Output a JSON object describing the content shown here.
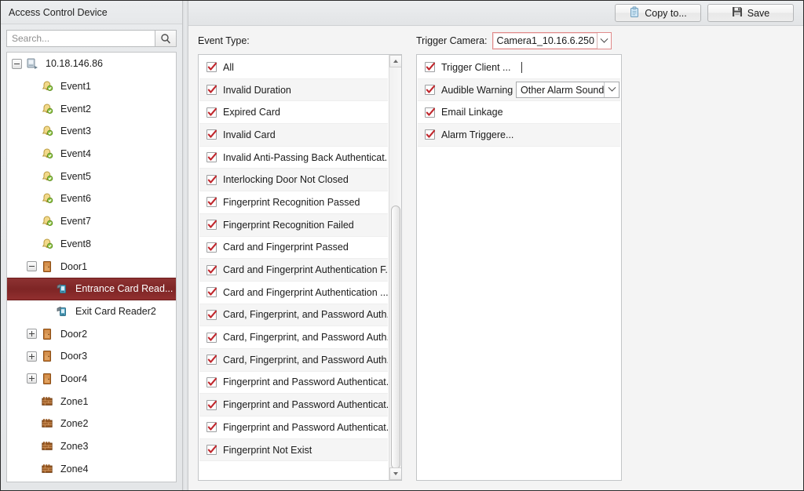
{
  "left_panel": {
    "header_title": "Access Control Device",
    "search": {
      "placeholder": "Search...",
      "value": "",
      "icon": "search-icon"
    },
    "tree": [
      {
        "label": "10.18.146.86",
        "icon": "device-icon",
        "indent": 0,
        "expander": "minus",
        "selected": false
      },
      {
        "label": "Event1",
        "icon": "bell-icon",
        "indent": 1,
        "expander": "none",
        "selected": false
      },
      {
        "label": "Event2",
        "icon": "bell-icon",
        "indent": 1,
        "expander": "none",
        "selected": false
      },
      {
        "label": "Event3",
        "icon": "bell-icon",
        "indent": 1,
        "expander": "none",
        "selected": false
      },
      {
        "label": "Event4",
        "icon": "bell-icon",
        "indent": 1,
        "expander": "none",
        "selected": false
      },
      {
        "label": "Event5",
        "icon": "bell-icon",
        "indent": 1,
        "expander": "none",
        "selected": false
      },
      {
        "label": "Event6",
        "icon": "bell-icon",
        "indent": 1,
        "expander": "none",
        "selected": false
      },
      {
        "label": "Event7",
        "icon": "bell-icon",
        "indent": 1,
        "expander": "none",
        "selected": false
      },
      {
        "label": "Event8",
        "icon": "bell-icon",
        "indent": 1,
        "expander": "none",
        "selected": false
      },
      {
        "label": "Door1",
        "icon": "door-icon",
        "indent": 1,
        "expander": "minus",
        "selected": false
      },
      {
        "label": "Entrance Card Read...",
        "icon": "card-reader-icon",
        "indent": 2,
        "expander": "none",
        "selected": true
      },
      {
        "label": "Exit Card Reader2",
        "icon": "card-reader-icon",
        "indent": 2,
        "expander": "none",
        "selected": false
      },
      {
        "label": "Door2",
        "icon": "door-icon",
        "indent": 1,
        "expander": "plus",
        "selected": false
      },
      {
        "label": "Door3",
        "icon": "door-icon",
        "indent": 1,
        "expander": "plus",
        "selected": false
      },
      {
        "label": "Door4",
        "icon": "door-icon",
        "indent": 1,
        "expander": "plus",
        "selected": false
      },
      {
        "label": "Zone1",
        "icon": "zone-icon",
        "indent": 1,
        "expander": "none",
        "selected": false
      },
      {
        "label": "Zone2",
        "icon": "zone-icon",
        "indent": 1,
        "expander": "none",
        "selected": false
      },
      {
        "label": "Zone3",
        "icon": "zone-icon",
        "indent": 1,
        "expander": "none",
        "selected": false
      },
      {
        "label": "Zone4",
        "icon": "zone-icon",
        "indent": 1,
        "expander": "none",
        "selected": false
      }
    ]
  },
  "toolbar": {
    "copy_to_label": "Copy to...",
    "copy_to_icon": "clipboard-icon",
    "save_label": "Save",
    "save_icon": "floppy-disk-icon"
  },
  "event_panel": {
    "label": "Event Type:",
    "rows": [
      {
        "label": "All",
        "checked": true
      },
      {
        "label": "Invalid Duration",
        "checked": true
      },
      {
        "label": "Expired Card",
        "checked": true
      },
      {
        "label": "Invalid Card",
        "checked": true
      },
      {
        "label": "Invalid Anti-Passing Back Authenticat...",
        "checked": true
      },
      {
        "label": "Interlocking Door Not Closed",
        "checked": true
      },
      {
        "label": "Fingerprint Recognition Passed",
        "checked": true
      },
      {
        "label": "Fingerprint Recognition Failed",
        "checked": true
      },
      {
        "label": "Card and Fingerprint Passed",
        "checked": true
      },
      {
        "label": "Card and Fingerprint Authentication F...",
        "checked": true
      },
      {
        "label": "Card and Fingerprint Authentication ...",
        "checked": true
      },
      {
        "label": "Card, Fingerprint, and Password Auth...",
        "checked": true
      },
      {
        "label": "Card, Fingerprint, and Password Auth...",
        "checked": true
      },
      {
        "label": "Card, Fingerprint, and Password Auth...",
        "checked": true
      },
      {
        "label": "Fingerprint and Password Authenticat...",
        "checked": true
      },
      {
        "label": "Fingerprint and Password Authenticat...",
        "checked": true
      },
      {
        "label": "Fingerprint and Password Authenticat...",
        "checked": true
      },
      {
        "label": "Fingerprint Not Exist",
        "checked": true
      }
    ],
    "scrollbar": {
      "thumb_top_pct": 34,
      "thumb_height_pct": 62
    }
  },
  "linkage_panel": {
    "trigger_camera_label": "Trigger Camera:",
    "trigger_camera_value": "Camera1_10.16.6.250",
    "rows": [
      {
        "label": "Trigger Client ...",
        "checked": true,
        "has_caret": true,
        "control": null
      },
      {
        "label": "Audible Warning",
        "checked": true,
        "has_caret": false,
        "control": "Other Alarm Sound"
      },
      {
        "label": "Email Linkage",
        "checked": true,
        "has_caret": false,
        "control": null
      },
      {
        "label": "Alarm Triggere...",
        "checked": true,
        "has_caret": false,
        "control": null
      }
    ]
  },
  "colors": {
    "selection_red": "#7e2525",
    "check_red": "#c0272d",
    "focus_border": "#e08a8a",
    "panel_bg": "#f4f4f4"
  }
}
